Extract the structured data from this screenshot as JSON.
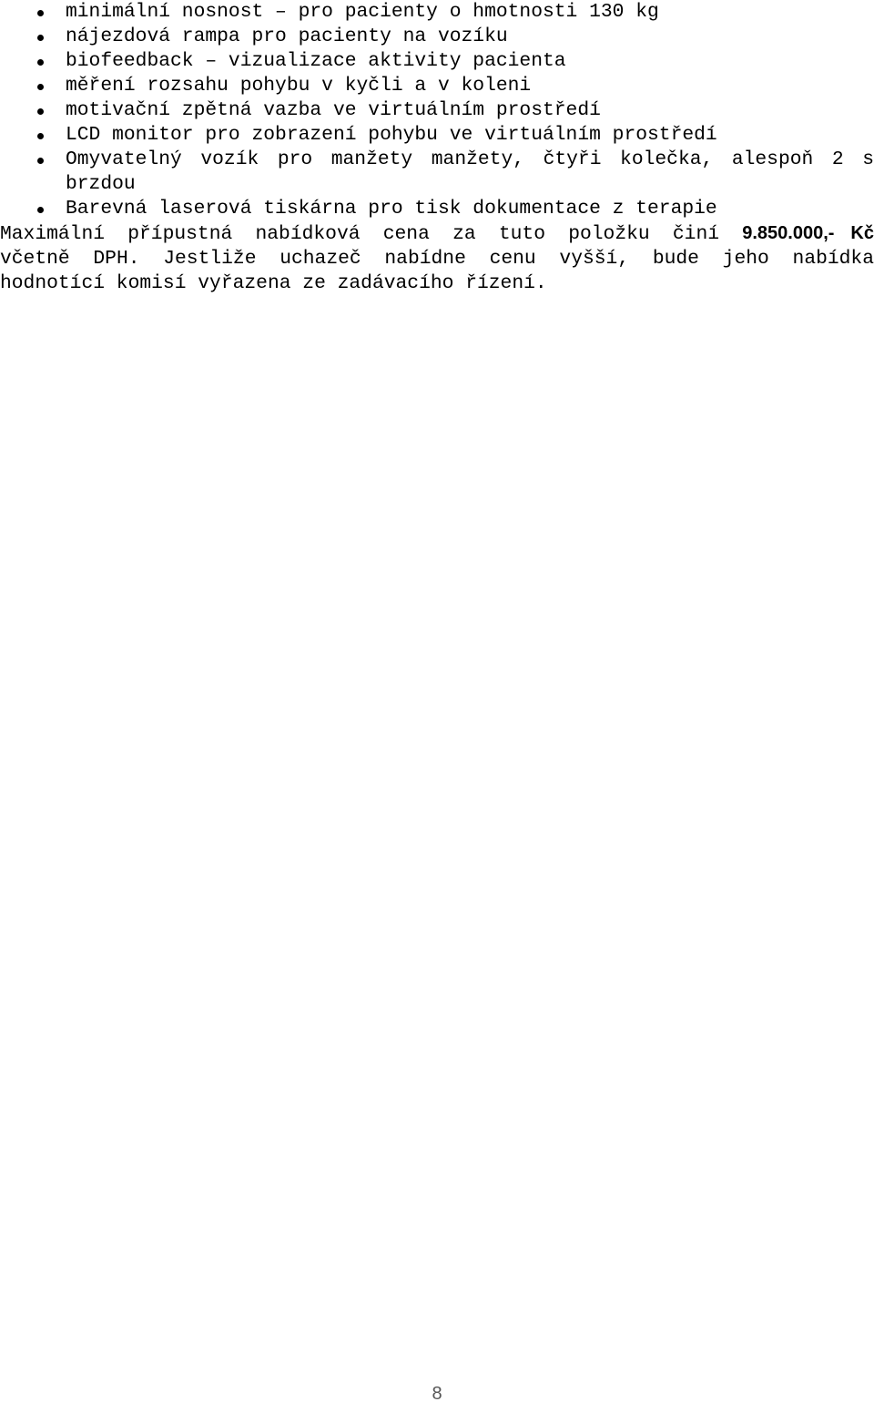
{
  "document": {
    "language": "cs",
    "page_number": "8",
    "text_color": "#000000",
    "background_color": "#ffffff"
  },
  "spec_list": {
    "bullet_glyph": "•",
    "items": [
      {
        "text": "minimální nosnost – pro pacienty o hmotnosti 130 kg"
      },
      {
        "text": "nájezdová rampa pro pacienty na vozíku"
      },
      {
        "text": "biofeedback – vizualizace aktivity pacienta"
      },
      {
        "text": "měření rozsahu pohybu v kyčli a v koleni"
      },
      {
        "text": "motivační zpětná vazba ve virtuálním prostředí"
      },
      {
        "text": "LCD monitor pro zobrazení pohybu ve virtuálním prostředí"
      },
      {
        "line_1": "Omyvatelný vozík pro manžety manžety, čtyři kolečka, alespoň 2 s",
        "line_2": "brzdou"
      },
      {
        "text": "Barevná laserová tiskárna pro tisk dokumentace z terapie"
      }
    ]
  },
  "price_paragraph": {
    "line_1_prefix": "Maximální přípustná nabídková cena za tuto položku činí",
    "amount": "9.850.000,- Kč",
    "line_2": "včetně DPH. Jestliže uchazeč nabídne cenu vyšší, bude jeho nabídka",
    "line_3": "hodnotící komisí vyřazena ze zadávacího řízení."
  }
}
